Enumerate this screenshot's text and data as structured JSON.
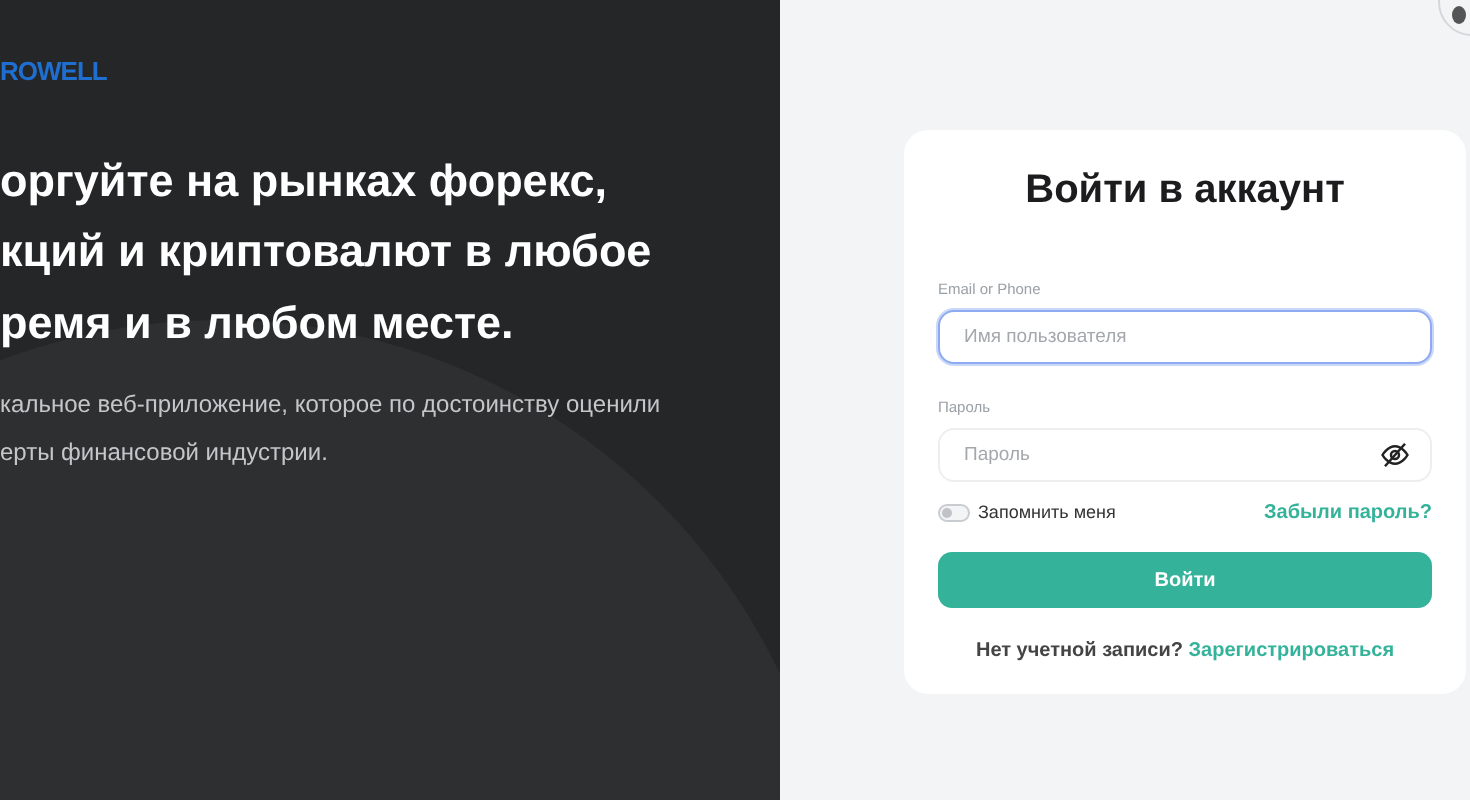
{
  "brand": {
    "logo": "ROWELL"
  },
  "hero": {
    "headline_lines": [
      "оргуйте на рынках форекс,",
      "кций и криптовалют в любое",
      "ремя и в любом месте."
    ],
    "subtitle_lines": [
      "кальное веб-приложение, которое по достоинству оценили",
      "ерты финансовой индустрии."
    ]
  },
  "login": {
    "title": "Войти в аккаунт",
    "fields": [
      {
        "label": "Email or Phone",
        "placeholder": "Имя пользователя",
        "focused": true,
        "kind": "text"
      },
      {
        "label": "Пароль",
        "placeholder": "Пароль",
        "focused": false,
        "kind": "password"
      }
    ],
    "remember": {
      "label": "Запомнить меня",
      "on": false
    },
    "forgot_link": "Забыли пароль?",
    "submit": "Войти",
    "signup_prompt": "Нет учетной записи?",
    "signup_link": "Зарегистрироваться"
  }
}
